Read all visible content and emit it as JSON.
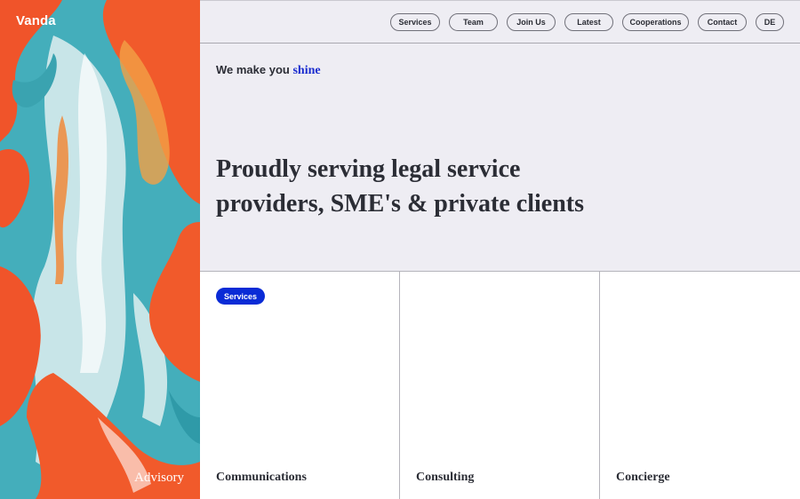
{
  "brand": {
    "logo": "Vanda",
    "art_caption": "Advisory"
  },
  "nav": {
    "items": [
      {
        "label": "Services"
      },
      {
        "label": "Team"
      },
      {
        "label": "Join Us"
      },
      {
        "label": "Latest"
      },
      {
        "label": "Cooperations"
      },
      {
        "label": "Contact"
      },
      {
        "label": "DE"
      }
    ]
  },
  "hero": {
    "tagline_prefix": "We make you",
    "tagline_accent": "shine",
    "headline": "Proudly serving legal service providers, SME's & private clients"
  },
  "cards": [
    {
      "badge": "Services",
      "title": "Communications"
    },
    {
      "title": "Consulting"
    },
    {
      "title": "Concierge"
    }
  ],
  "colors": {
    "accent": "#0a2bd6",
    "hero_bg": "#eeedf3",
    "paint_orange": "#f0542a",
    "paint_teal": "#3fa9b5"
  }
}
